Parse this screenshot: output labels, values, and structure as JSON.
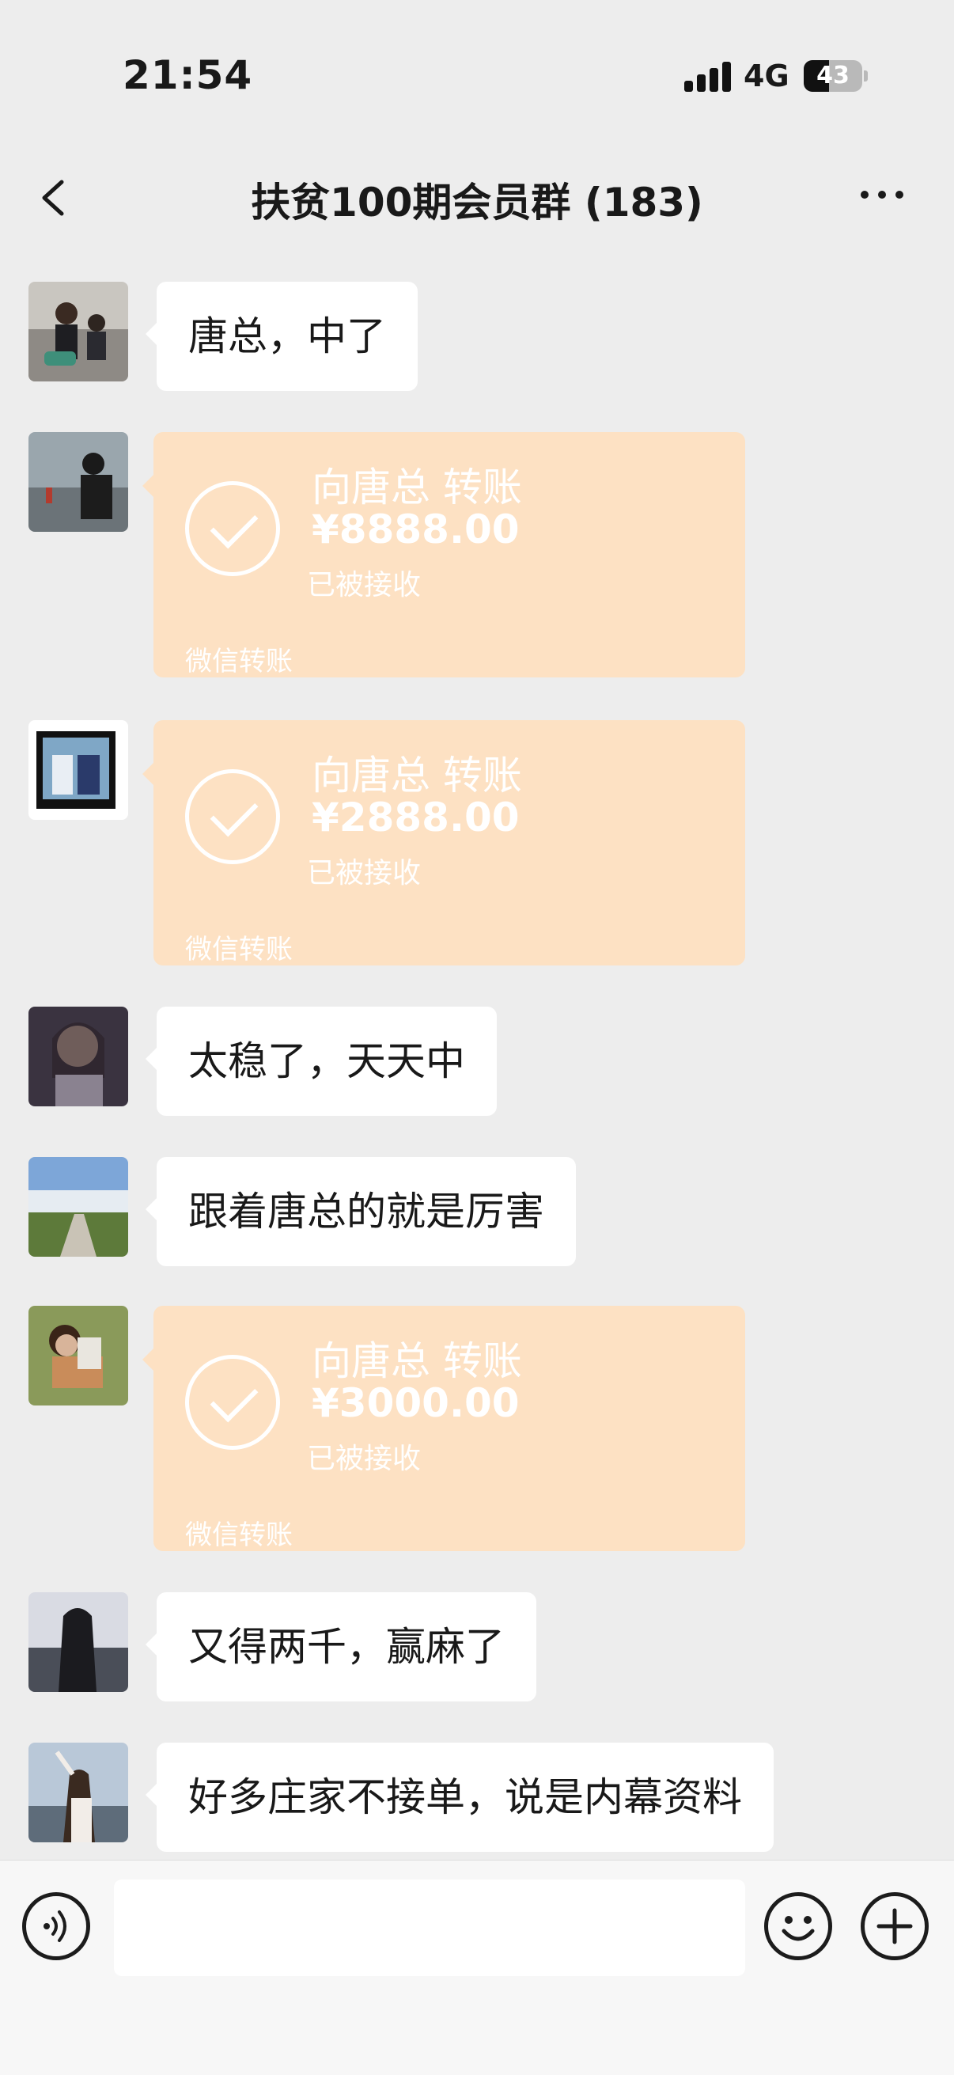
{
  "status_bar": {
    "time": "21:54",
    "network": "4G",
    "battery": "43"
  },
  "header": {
    "title": "扶贫100期会员群 (183)"
  },
  "messages": [
    {
      "type": "text",
      "text": "唐总，中了"
    },
    {
      "type": "transfer",
      "title": "向唐总 转账",
      "amount": "¥8888.00",
      "status": "已被接收",
      "source": "微信转账"
    },
    {
      "type": "transfer",
      "title": "向唐总 转账",
      "amount": "¥2888.00",
      "status": "已被接收",
      "source": "微信转账"
    },
    {
      "type": "text",
      "text": "太稳了，天天中"
    },
    {
      "type": "text",
      "text": "跟着唐总的就是厉害"
    },
    {
      "type": "transfer",
      "title": "向唐总 转账",
      "amount": "¥3000.00",
      "status": "已被接收",
      "source": "微信转账"
    },
    {
      "type": "text",
      "text": "又得两千，赢麻了"
    },
    {
      "type": "text",
      "text": "好多庄家不接单，说是内幕资料"
    }
  ],
  "input_bar": {
    "value": ""
  },
  "colors": {
    "background": "#ededed",
    "bubble": "#ffffff",
    "transfer": "#fde1c3",
    "text": "#191919"
  },
  "icons": [
    "back-icon",
    "more-icon",
    "voice-icon",
    "emoji-icon",
    "plus-icon",
    "check-icon"
  ]
}
